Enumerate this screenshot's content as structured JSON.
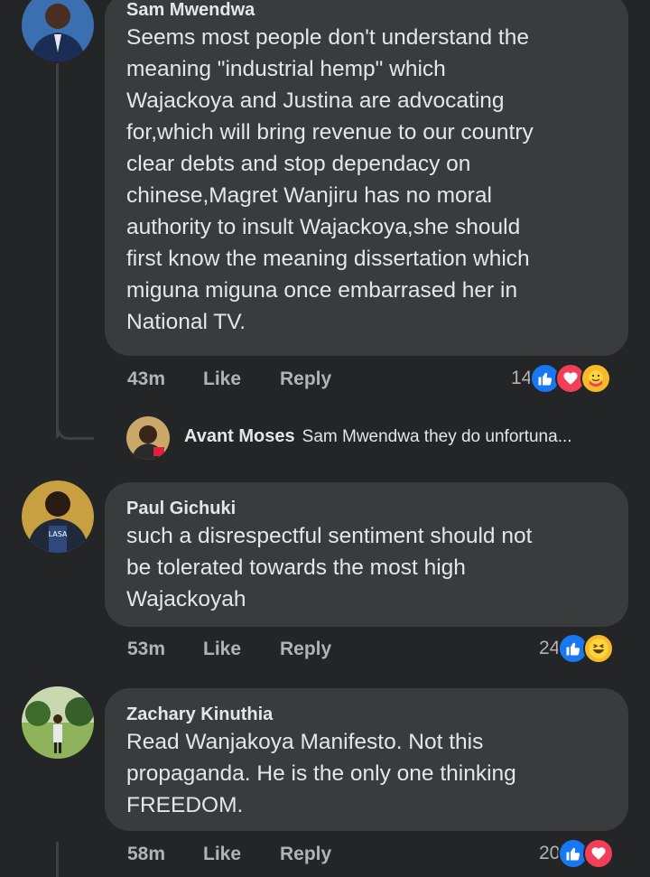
{
  "comments": [
    {
      "author": "Sam Mwendwa",
      "text": "Seems most people don't understand the meaning \"industrial hemp\" which Wajackoya and Justina are advocating for,which will bring revenue to our country clear debts and stop dependacy on chinese,Magret Wanjiru has no moral authority to insult Wajackoya,she should first know the meaning dissertation which miguna miguna once embarrased her in National TV.",
      "lines": [
        "Seems most people don't understand the",
        "meaning \"industrial hemp\" which",
        "Wajackoya and Justina are advocating",
        "for,which will bring revenue to our country",
        "clear debts and stop dependacy on",
        "chinese,Magret Wanjiru has no moral",
        "authority to insult Wajackoya,she should",
        "first know the meaning dissertation which",
        "miguna miguna once embarrased her in",
        "National TV."
      ],
      "time": "43m",
      "like_label": "Like",
      "reply_label": "Reply",
      "reaction_count": "14",
      "reactions": [
        "like-icon",
        "love-icon",
        "care-icon"
      ]
    },
    {
      "author": "Paul Gichuki",
      "lines": [
        "such a disrespectful sentiment should not",
        "be tolerated towards the most high",
        "Wajackoyah"
      ],
      "time": "53m",
      "like_label": "Like",
      "reply_label": "Reply",
      "reaction_count": "24",
      "reactions": [
        "like-icon",
        "haha-icon"
      ]
    },
    {
      "author": "Zachary Kinuthia",
      "lines": [
        "Read Wanjakoya Manifesto. Not this",
        "propaganda. He is the only one thinking",
        "FREEDOM."
      ],
      "time": "58m",
      "like_label": "Like",
      "reply_label": "Reply",
      "reaction_count": "20",
      "reactions": [
        "like-icon",
        "love-icon"
      ]
    }
  ],
  "reply_preview": {
    "author": "Avant Moses",
    "text": "Sam Mwendwa they do unfortuna..."
  },
  "colors": {
    "background": "#242526",
    "bubble": "#3a3b3c",
    "text": "#e4e6eb",
    "secondary": "#b0b3b8",
    "like_blue": "#1877f2",
    "love_red": "#f33e58",
    "yellow": "#f7b928"
  }
}
